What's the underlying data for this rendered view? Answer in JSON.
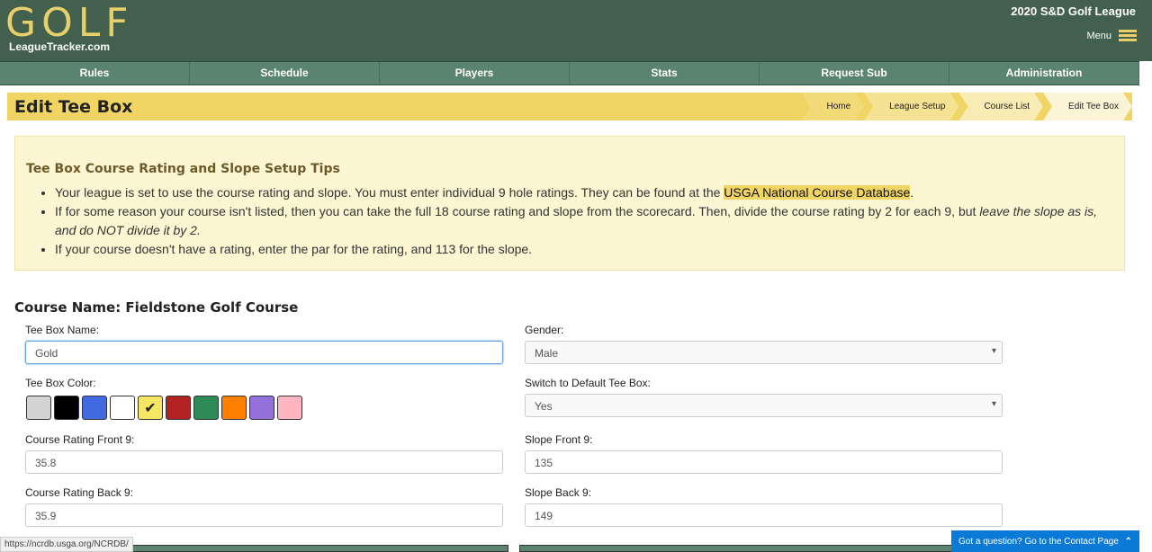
{
  "header": {
    "logo_text": "GOLF",
    "logo_sub": "LeagueTracker.com",
    "league_name": "2020 S&D Golf League",
    "menu_label": "Menu"
  },
  "nav": [
    "Rules",
    "Schedule",
    "Players",
    "Stats",
    "Request Sub",
    "Administration"
  ],
  "page_title": "Edit Tee Box",
  "breadcrumb": [
    "Home",
    "League Setup",
    "Course List",
    "Edit Tee Box"
  ],
  "tips": {
    "title": "Tee Box Course Rating and Slope Setup Tips",
    "item1_pre": "Your league is set to use the course rating and slope. You must enter individual 9 hole ratings. They can be found at the ",
    "item1_link": "USGA National Course Database",
    "item1_post": ".",
    "item2_pre": "If for some reason your course isn't listed, then you can take the full 18 course rating and slope from the scorecard. Then, divide the course rating by 2 for each 9, but ",
    "item2_em": "leave the slope as is, and do NOT divide it by 2.",
    "item3": "If your course doesn't have a rating, enter the par for the rating, and 113 for the slope."
  },
  "course_name": "Course Name: Fieldstone Golf Course",
  "form": {
    "tee_box_name_label": "Tee Box Name:",
    "tee_box_name": "Gold",
    "gender_label": "Gender:",
    "gender": "Male",
    "color_label": "Tee Box Color:",
    "colors": [
      "#d3d3d3",
      "#000000",
      "#4169e1",
      "#ffffff",
      "#f5e663",
      "#b22222",
      "#2e8b57",
      "#ff7f00",
      "#9370db",
      "#ffb6c1"
    ],
    "selected_color_index": 4,
    "default_label": "Switch to Default Tee Box:",
    "default": "Yes",
    "cr_front_label": "Course Rating Front 9:",
    "cr_front": "35.8",
    "slope_front_label": "Slope Front 9:",
    "slope_front": "135",
    "cr_back_label": "Course Rating Back 9:",
    "cr_back": "35.9",
    "slope_back_label": "Slope Back 9:",
    "slope_back": "149"
  },
  "status_url": "https://ncrdb.usga.org/NCRDB/",
  "chat": "Got a question? Go to the Contact Page"
}
